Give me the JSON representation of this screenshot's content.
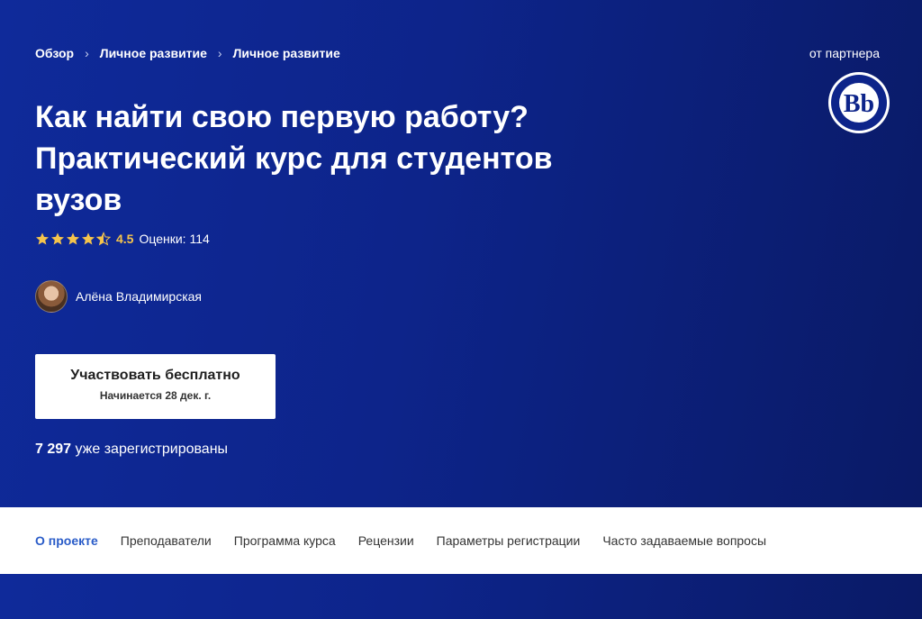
{
  "breadcrumb": {
    "items": [
      "Обзор",
      "Личное развитие",
      "Личное развитие"
    ]
  },
  "partner": {
    "label": "от партнера",
    "logo_icon": "hse-university-logo"
  },
  "course": {
    "title_lines": [
      "Как найти свою первую работу?",
      "Практический курс для студентов",
      "вузов"
    ]
  },
  "rating": {
    "value": "4.5",
    "count_text": "Оценки: 114",
    "stars": 4.5,
    "star_color": "#f5c44c"
  },
  "instructor": {
    "name": "Алёна Владимирская"
  },
  "cta": {
    "label": "Участвовать бесплатно",
    "sub": "Начинается 28 дек. г."
  },
  "enrolled": {
    "count": "7 297",
    "text": " уже зарегистрированы"
  },
  "tabs": [
    {
      "label": "О проекте",
      "active": true
    },
    {
      "label": "Преподаватели"
    },
    {
      "label": "Программа курса"
    },
    {
      "label": "Рецензии"
    },
    {
      "label": "Параметры регистрации"
    },
    {
      "label": "Часто задаваемые вопросы"
    }
  ],
  "colors": {
    "hero": "#0d248a",
    "accent": "#2a5cc8",
    "star": "#f5c44c"
  }
}
